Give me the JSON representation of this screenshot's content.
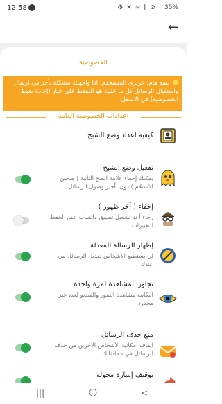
{
  "status_bar": {
    "time": "12:58",
    "icons": "⚙ ✕ ≋ ∥ ⊘",
    "battery": "35%"
  },
  "app_bar": {
    "back_glyph": "←"
  },
  "sections": {
    "privacy_title": "الخصوصية",
    "general_title": "اعدادات الخصوصية العامة"
  },
  "warning": {
    "text": "تنبيه هام: عزيزي المستخدم، اذا واجهتك مشكلة تأخر في ارسال واستقبال الرسائل كل ما عليك هو الضغط على خيار (إعادة ضبط الخصوصية) في الاسفل"
  },
  "rows": [
    {
      "title": "كيفية اعداد وضع الشبح",
      "desc": "",
      "toggle": null,
      "icon": "ghost-guide-icon"
    },
    {
      "title": "تفعيل وضع الشبح",
      "desc": "يمكنك إخفاء علامة الصح الثانية ( صحين الاستلام ) دون تأخير وصول الرسائل",
      "toggle": true,
      "icon": "ghost-icon"
    },
    {
      "title": "إخفاء ( آخر ظهور )",
      "desc": "رجاء أعد تشغيل تطبيق واتساب عمار لحفظ التغييرات",
      "toggle": false,
      "icon": "spy-icon"
    },
    {
      "title": "إظهار الرسالة المعدلة",
      "desc": "لن يستطيع الأشخاص تعديل الرسائل من عندك",
      "toggle": true,
      "icon": "pen-icon"
    },
    {
      "title": "تجاوز المشاهدة لمرة واحدة",
      "desc": "امكانية مشاهدة الصور والفيديو لعدد غير محدود",
      "toggle": true,
      "icon": "eye-icon"
    },
    {
      "title": "منع حذف الرسائل",
      "desc": "ايقاف امكانية الأشخاص الاخرين من حذف الرسائل في محادثاتك",
      "toggle": true,
      "icon": "mail-icon"
    },
    {
      "title": "توقيف إشارة محولة",
      "desc": "",
      "toggle": true,
      "icon": "forward-icon"
    }
  ],
  "nav": {
    "recents": "|||",
    "home": "○",
    "back": "<"
  },
  "colors": {
    "accent": "#f6a623",
    "toggle_on": "#2aa44f",
    "section_text": "#e49a17"
  }
}
